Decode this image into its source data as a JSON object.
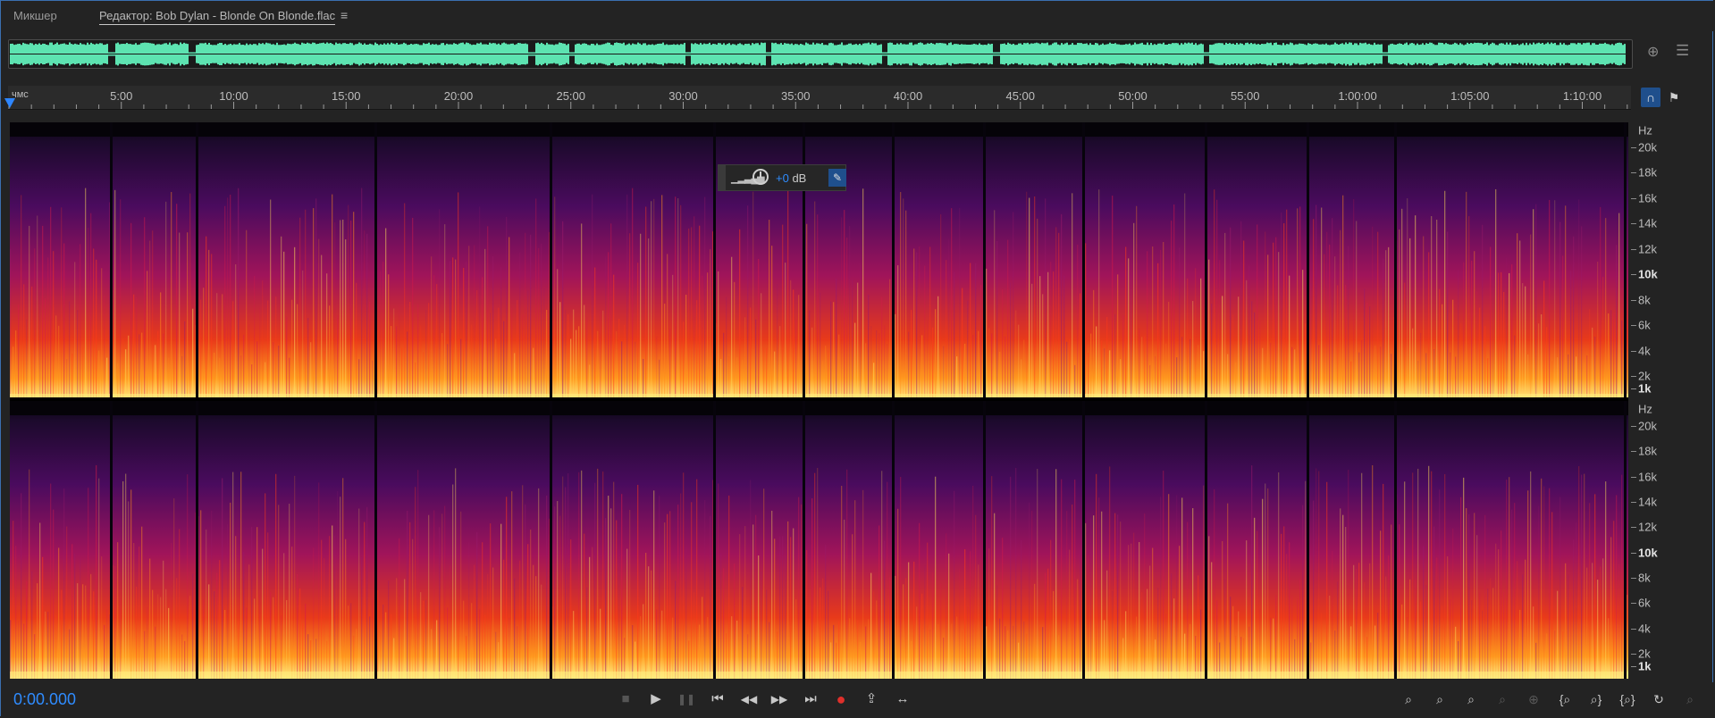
{
  "tabs": [
    {
      "label": "Микшер",
      "active": false
    },
    {
      "label": "Редактор: Bob Dylan - Blonde On Blonde.flac",
      "active": true
    }
  ],
  "tab_menu_icon": "≡",
  "overview": {
    "color": "#5de3b1",
    "icons": [
      "zoom-to-selection-icon",
      "panel-menu-icon"
    ]
  },
  "ruler": {
    "unit": "чмс",
    "labels": [
      "5:00",
      "10:00",
      "15:00",
      "20:00",
      "25:00",
      "30:00",
      "35:00",
      "40:00",
      "45:00",
      "50:00",
      "55:00",
      "1:00:00",
      "1:05:00",
      "1:10:00"
    ]
  },
  "side_buttons": {
    "monitor_icon": "headphones-icon",
    "marker_icon": "marker-icon"
  },
  "frequency_scale": {
    "unit": "Hz",
    "ticks": [
      "20k",
      "18k",
      "16k",
      "14k",
      "12k",
      "10k",
      "8k",
      "6k",
      "4k",
      "2k",
      "1k"
    ],
    "bold": [
      "10k",
      "1k"
    ]
  },
  "channels": [
    "left",
    "right"
  ],
  "hud": {
    "value": "+0",
    "unit": "dB"
  },
  "current_time": "0:00.000",
  "transport": {
    "stop": "■",
    "play": "▶",
    "pause": "❚❚",
    "to_start": "⏮",
    "rewind": "◀◀",
    "fast_forward": "▶▶",
    "to_end": "⏭",
    "record": "●",
    "loop": "⇪",
    "skip": "↔"
  },
  "zoom_tools": [
    "zoom-in-amplitude",
    "zoom-out-amplitude",
    "zoom-in-time",
    "zoom-out-time",
    "zoom-full",
    "zoom-in-left",
    "zoom-in-right",
    "zoom-out-full",
    "zoom-reset",
    "zoom-selection"
  ],
  "colors": {
    "accent": "#2f8cff",
    "waveform": "#5de3b1",
    "record": "#e0302b"
  }
}
